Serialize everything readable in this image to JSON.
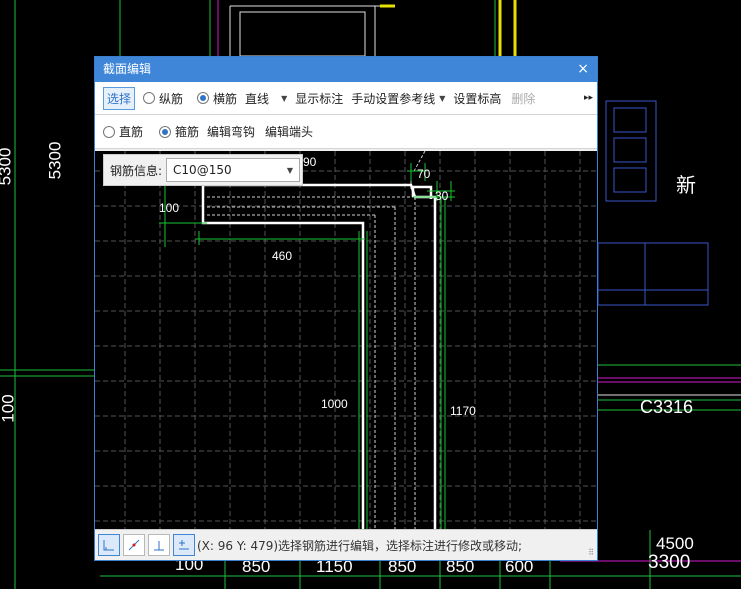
{
  "cad": {
    "left_dim_1": "5300",
    "left_dim_2": "5300",
    "left_dim_3": "100",
    "xin_label": "新",
    "c_label": "C3316",
    "bottom_dims": [
      "100",
      "850",
      "1150",
      "850",
      "850",
      "600"
    ],
    "right_dim_upper": "4500",
    "right_dim_lower": "3300"
  },
  "dialog": {
    "title": "截面编辑",
    "close_glyph": "×",
    "toolbar1": {
      "select": "选择",
      "longitudinal": "纵筋",
      "transverse": "横筋",
      "line_type": "直线",
      "show_dim": "显示标注",
      "manual_ref": "手动设置参考线",
      "set_elev": "设置标高",
      "delete": "删除",
      "more": "▸▸"
    },
    "toolbar2": {
      "straight": "直筋",
      "stirrup": "箍筋",
      "edit_hook": "编辑弯钩",
      "edit_end": "编辑端头"
    },
    "rebar_info": {
      "label": "钢筋信息:",
      "value": "C10@150"
    },
    "dims": {
      "top": "90",
      "d70": "70",
      "d30": "30",
      "d100": "100",
      "d460": "460",
      "d1000": "1000",
      "d1170": "1170"
    },
    "status": "(X: 96 Y: 479)选择钢筋进行编辑，选择标注进行修改或移动;"
  }
}
